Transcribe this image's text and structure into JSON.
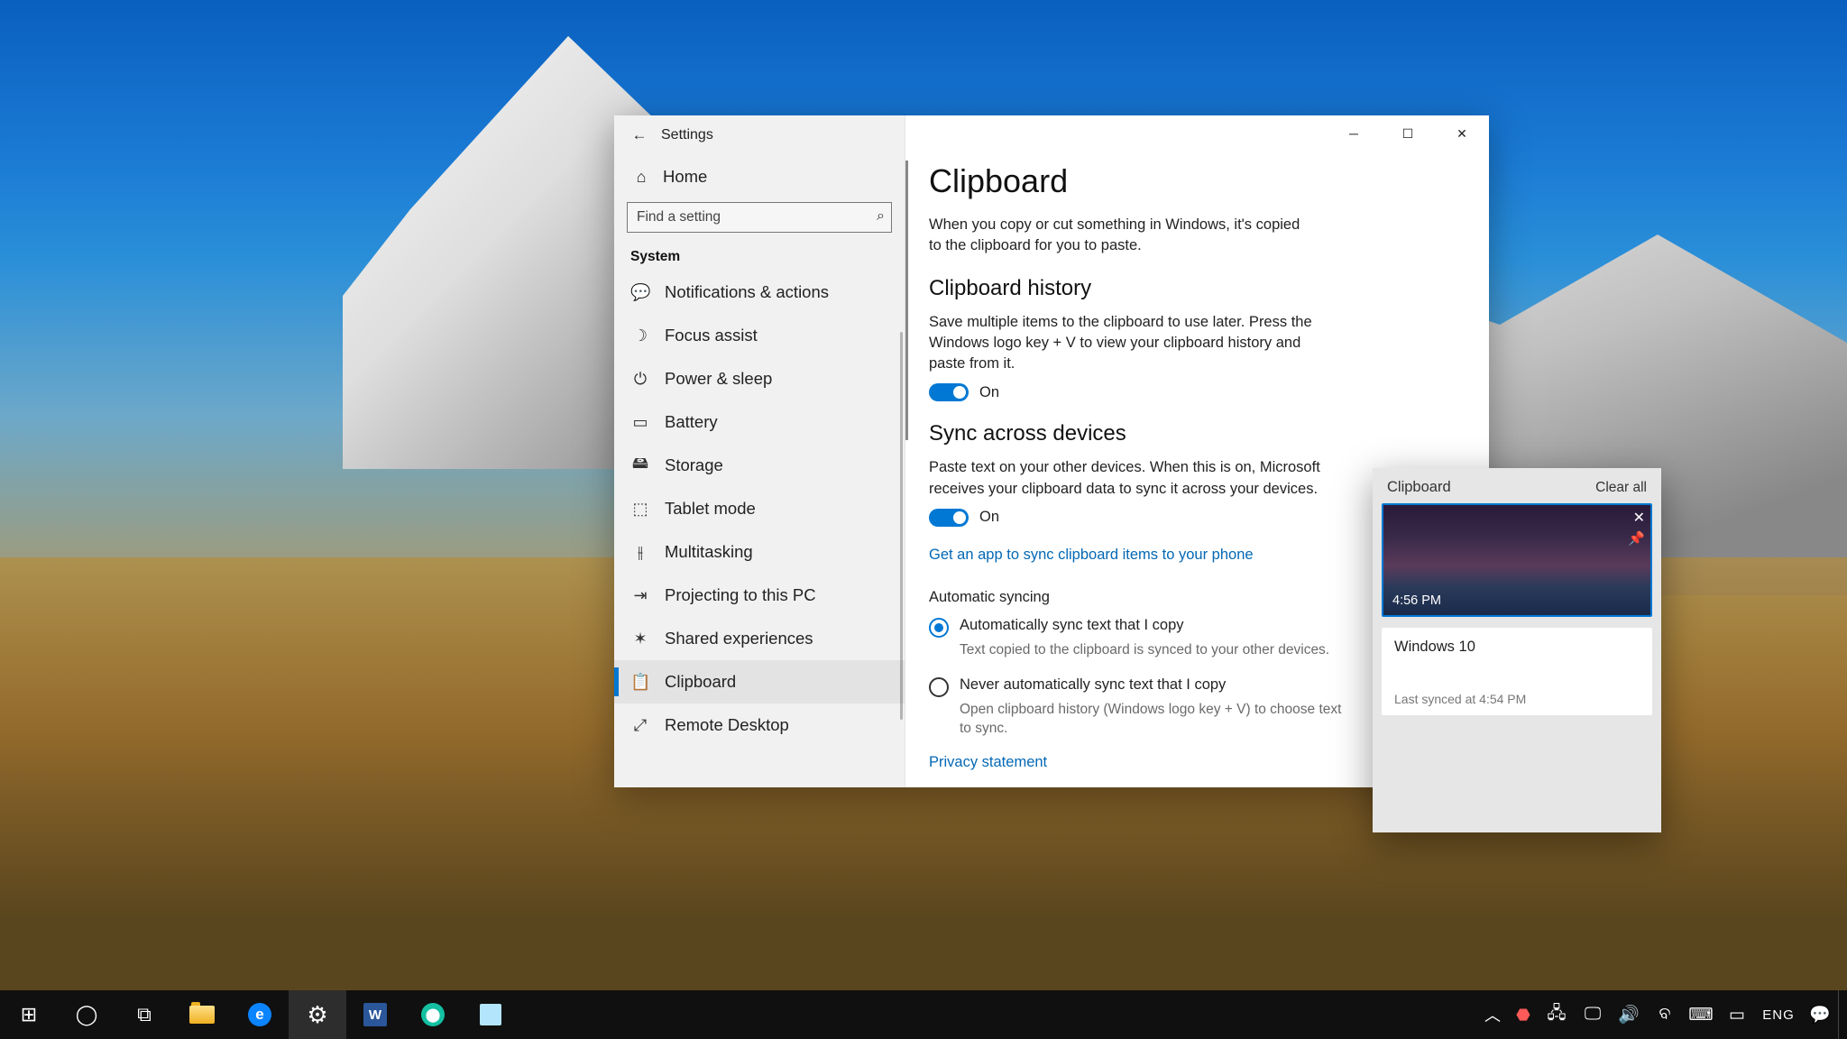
{
  "settings": {
    "title": "Settings",
    "home": "Home",
    "search_placeholder": "Find a setting",
    "group": "System",
    "nav": [
      {
        "icon": "💬",
        "label": "Notifications & actions"
      },
      {
        "icon": "☽",
        "label": "Focus assist"
      },
      {
        "icon": "⏻",
        "label": "Power & sleep"
      },
      {
        "icon": "▭",
        "label": "Battery"
      },
      {
        "icon": "🖴",
        "label": "Storage"
      },
      {
        "icon": "⬚",
        "label": "Tablet mode"
      },
      {
        "icon": "⫲",
        "label": "Multitasking"
      },
      {
        "icon": "⇥",
        "label": "Projecting to this PC"
      },
      {
        "icon": "✶",
        "label": "Shared experiences"
      },
      {
        "icon": "📋",
        "label": "Clipboard"
      },
      {
        "icon": "⤢",
        "label": "Remote Desktop"
      }
    ],
    "active_index": 9
  },
  "page": {
    "h1": "Clipboard",
    "lead": "When you copy or cut something in Windows, it's copied to the clipboard for you to paste.",
    "history_h": "Clipboard history",
    "history_desc": "Save multiple items to the clipboard to use later. Press the Windows logo key + V to view your clipboard history and paste from it.",
    "history_state": "On",
    "sync_h": "Sync across devices",
    "sync_desc": "Paste text on your other devices. When this is on, Microsoft receives your clipboard data to sync it across your devices.",
    "sync_state": "On",
    "sync_link": "Get an app to sync clipboard items to your phone",
    "autosync_h": "Automatic syncing",
    "radio1_label": "Automatically sync text that I copy",
    "radio1_desc": "Text copied to the clipboard is synced to your other devices.",
    "radio2_label": "Never automatically sync text that I copy",
    "radio2_desc": "Open clipboard history (Windows logo key + V) to choose text to sync.",
    "privacy_link": "Privacy statement"
  },
  "flyout": {
    "title": "Clipboard",
    "clear": "Clear all",
    "img_time": "4:56 PM",
    "text_value": "Windows 10",
    "text_sync": "Last synced at 4:54 PM"
  },
  "taskbar": {
    "lang": "ENG"
  }
}
